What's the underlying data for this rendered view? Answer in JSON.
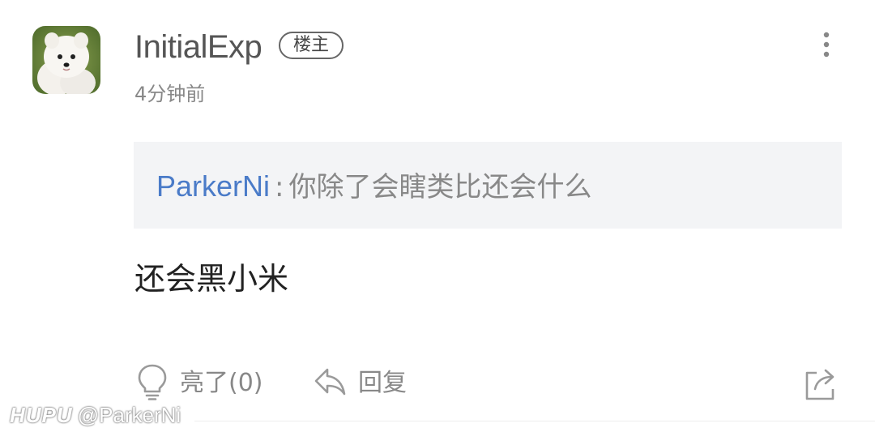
{
  "post": {
    "username": "InitialExp",
    "op_badge": "楼主",
    "timestamp": "4分钟前",
    "quote": {
      "author": "ParkerNi",
      "separator": ":",
      "text": "你除了会瞎类比还会什么"
    },
    "content": "还会黑小米"
  },
  "actions": {
    "like_label": "亮了(0)",
    "reply_label": "回复"
  },
  "icons": {
    "more": "more-vertical-icon",
    "like": "lightbulb-icon",
    "reply": "reply-arrow-icon",
    "share": "share-icon"
  },
  "watermark": {
    "logo": "HUPU",
    "user": "@ParkerNi"
  },
  "colors": {
    "link": "#4a7bc8",
    "quote_bg": "#f3f4f6",
    "muted_text": "#888888"
  }
}
